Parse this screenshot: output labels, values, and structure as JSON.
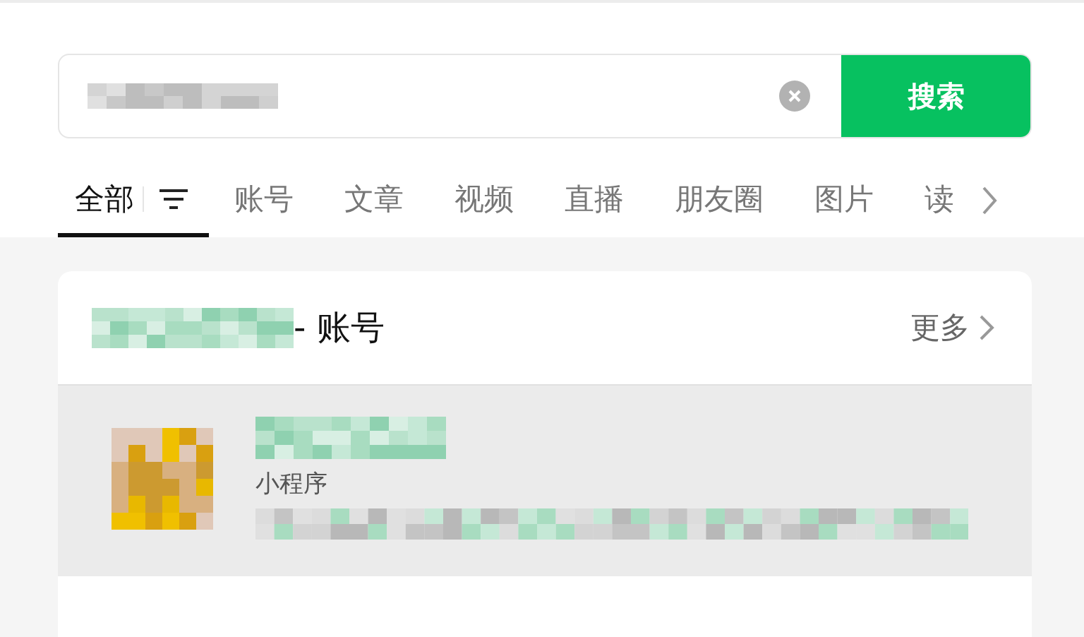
{
  "search": {
    "button": "搜索"
  },
  "tabs": [
    {
      "label": "全部",
      "selected": true,
      "filter": true
    },
    {
      "label": "账号",
      "selected": false
    },
    {
      "label": "文章",
      "selected": false
    },
    {
      "label": "视频",
      "selected": false
    },
    {
      "label": "直播",
      "selected": false
    },
    {
      "label": "朋友圈",
      "selected": false
    },
    {
      "label": "图片",
      "selected": false
    },
    {
      "label": "读",
      "selected": false
    }
  ],
  "section": {
    "title": "- 账号",
    "more": "更多"
  },
  "results": [
    {
      "kind": "picture",
      "type": "小程序",
      "selected": true
    }
  ]
}
